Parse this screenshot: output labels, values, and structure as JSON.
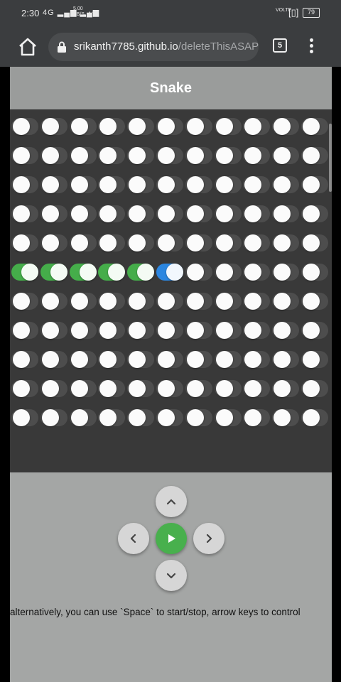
{
  "status_bar": {
    "time": "2:30",
    "signal": "4G ▂▄▆ ▂▄▆",
    "speed_value": "5.00",
    "speed_unit": "KB/S",
    "more": "···",
    "volte": "VOLTE",
    "vibrate": "[▯]",
    "battery": "79"
  },
  "browser": {
    "url_host": "srikanth7785.github.io",
    "url_path": "/deleteThisASAP",
    "tab_count": "5"
  },
  "page": {
    "title": "Snake",
    "hint": "alternatively, you can use `Space` to start/stop, arrow keys to control"
  },
  "game": {
    "rows": 11,
    "cols": 11,
    "snake_row": 5,
    "snake_body_cols": [
      0,
      1,
      2,
      3,
      4
    ],
    "snake_head_col": 5
  },
  "controls": {
    "up_icon": "chevron-up-icon",
    "left_icon": "chevron-left-icon",
    "play_icon": "play-icon",
    "right_icon": "chevron-right-icon",
    "down_icon": "chevron-down-icon"
  },
  "colors": {
    "snake_body": "#45ad4a",
    "snake_head": "#2b86e0",
    "board": "#393939",
    "play_button": "#48b04d"
  }
}
